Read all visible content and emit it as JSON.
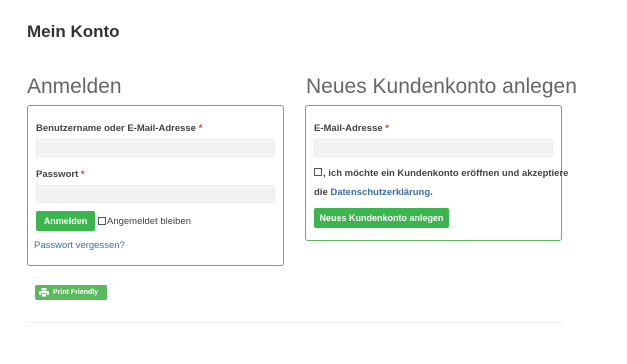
{
  "page": {
    "title": "Mein Konto"
  },
  "login": {
    "heading": "Anmelden",
    "username_label": "Benutzername oder E-Mail-Adresse",
    "required_mark": "*",
    "username_value": "",
    "password_label": "Passwort",
    "password_value": "",
    "submit_label": "Anmelden",
    "remember_label": "Angemeldet bleiben",
    "remember_checked": false,
    "forgot_link": "Passwort vergessen?"
  },
  "register": {
    "heading": "Neues Kundenkonto anlegen",
    "email_label": "E-Mail-Adresse",
    "required_mark": "*",
    "email_value": "",
    "consent_text": ", ich möchte ein Kundenkonto eröffnen und akzeptiere",
    "consent_prefix": "die",
    "privacy_link": "Datenschutzerklärung",
    "consent_suffix": ".",
    "consent_checked": false,
    "submit_label": "Neues Kundenkonto anlegen"
  },
  "print_button": {
    "label": "Print Friendly",
    "icon": "printer-icon"
  },
  "colors": {
    "accent": "#3bb64f",
    "border": "#5cb85c",
    "link": "#3a6fa8",
    "required": "#e2401c"
  }
}
